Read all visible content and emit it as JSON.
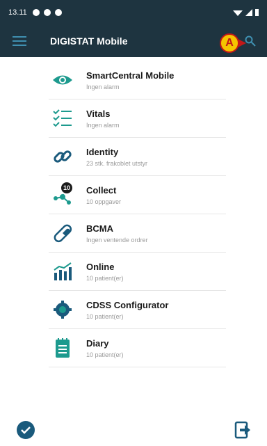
{
  "status_bar": {
    "time": "13.11"
  },
  "app_bar": {
    "title": "DIGISTAT Mobile",
    "callout_label": "A"
  },
  "items": [
    {
      "name": "SmartCentral Mobile",
      "sub": "Ingen alarm",
      "icon": "eye-icon"
    },
    {
      "name": "Vitals",
      "sub": "Ingen alarm",
      "icon": "checklist-icon"
    },
    {
      "name": "Identity",
      "sub": "23 stk. frakoblet utstyr",
      "icon": "link-icon"
    },
    {
      "name": "Collect",
      "sub": "10 oppgaver",
      "icon": "network-icon",
      "badge": "10"
    },
    {
      "name": "BCMA",
      "sub": "Ingen ventende ordrer",
      "icon": "pill-icon"
    },
    {
      "name": "Online",
      "sub": "10 patient(er)",
      "icon": "bar-chart-icon"
    },
    {
      "name": "CDSS Configurator",
      "sub": "10 patient(er)",
      "icon": "gear-shield-icon"
    },
    {
      "name": "Diary",
      "sub": "10 patient(er)",
      "icon": "notepad-icon"
    }
  ],
  "colors": {
    "header": "#1e3440",
    "icon_teal": "#1d9a8e",
    "icon_dark": "#1a5a7c",
    "callout_fill": "#f5c400",
    "callout_border": "#c21818"
  }
}
